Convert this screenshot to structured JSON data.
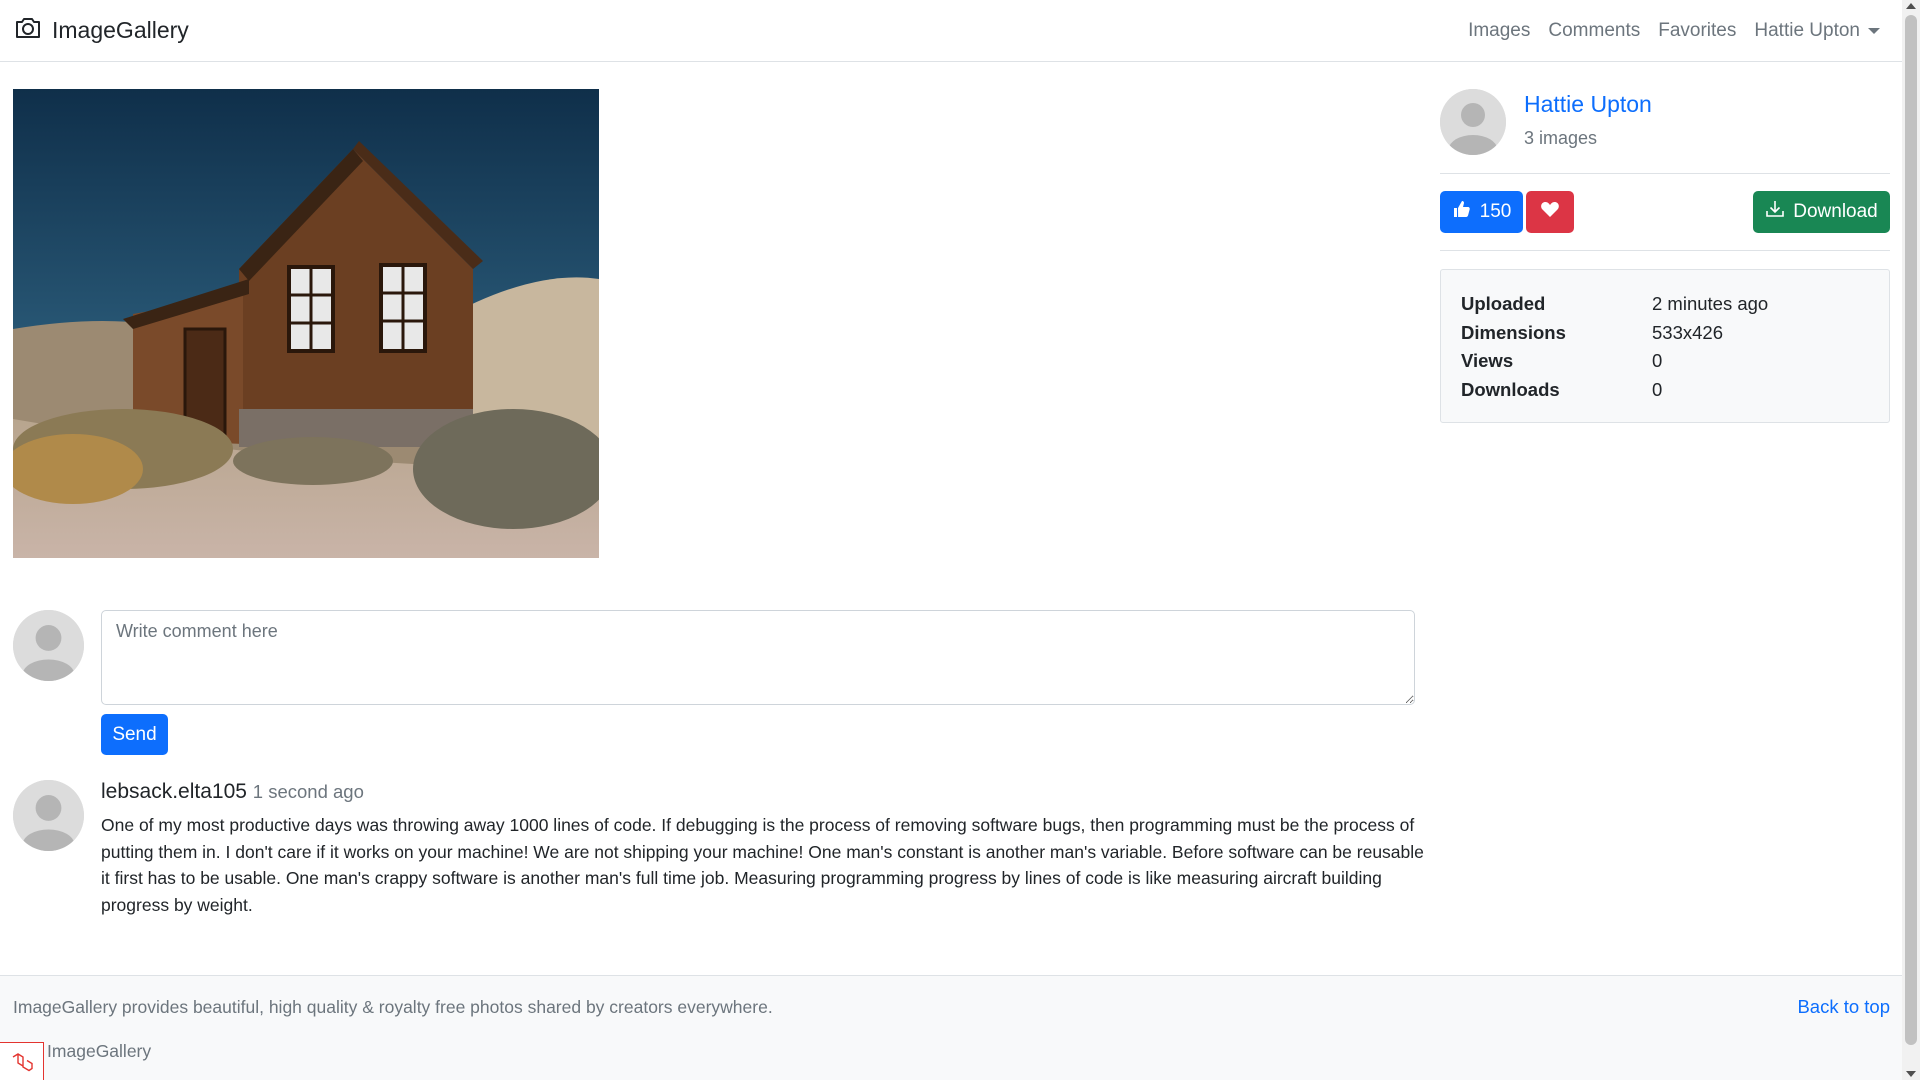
{
  "nav": {
    "brand": "ImageGallery",
    "links": [
      "Images",
      "Comments",
      "Favorites"
    ],
    "user": "Hattie Upton"
  },
  "author": {
    "name": "Hattie Upton",
    "count": "3 images"
  },
  "actions": {
    "likes": "150",
    "download": "Download"
  },
  "info": [
    {
      "key": "Uploaded",
      "value": "2 minutes ago"
    },
    {
      "key": "Dimensions",
      "value": "533x426"
    },
    {
      "key": "Views",
      "value": "0"
    },
    {
      "key": "Downloads",
      "value": "0"
    }
  ],
  "comment_form": {
    "placeholder": "Write comment here",
    "send": "Send"
  },
  "comments": [
    {
      "user": "lebsack.elta105",
      "time": "1 second ago",
      "text": "One of my most productive days was throwing away 1000 lines of code. If debugging is the process of removing software bugs, then programming must be the process of putting them in. I don't care if it works on your machine! We are not shipping your machine! One man's constant is another man's variable. Before software can be reusable it first has to be usable. One man's crappy software is another man's full time job. Measuring programming progress by lines of code is like measuring aircraft building progress by weight."
    }
  ],
  "footer": {
    "text": "ImageGallery provides beautiful, high quality & royalty free photos shared by creators everywhere.",
    "back_to_top": "Back to top",
    "copyright": "023 ImageGallery"
  },
  "colors": {
    "primary": "#0d6efd",
    "danger": "#dc3545",
    "success": "#198754",
    "muted": "#6c757d"
  }
}
